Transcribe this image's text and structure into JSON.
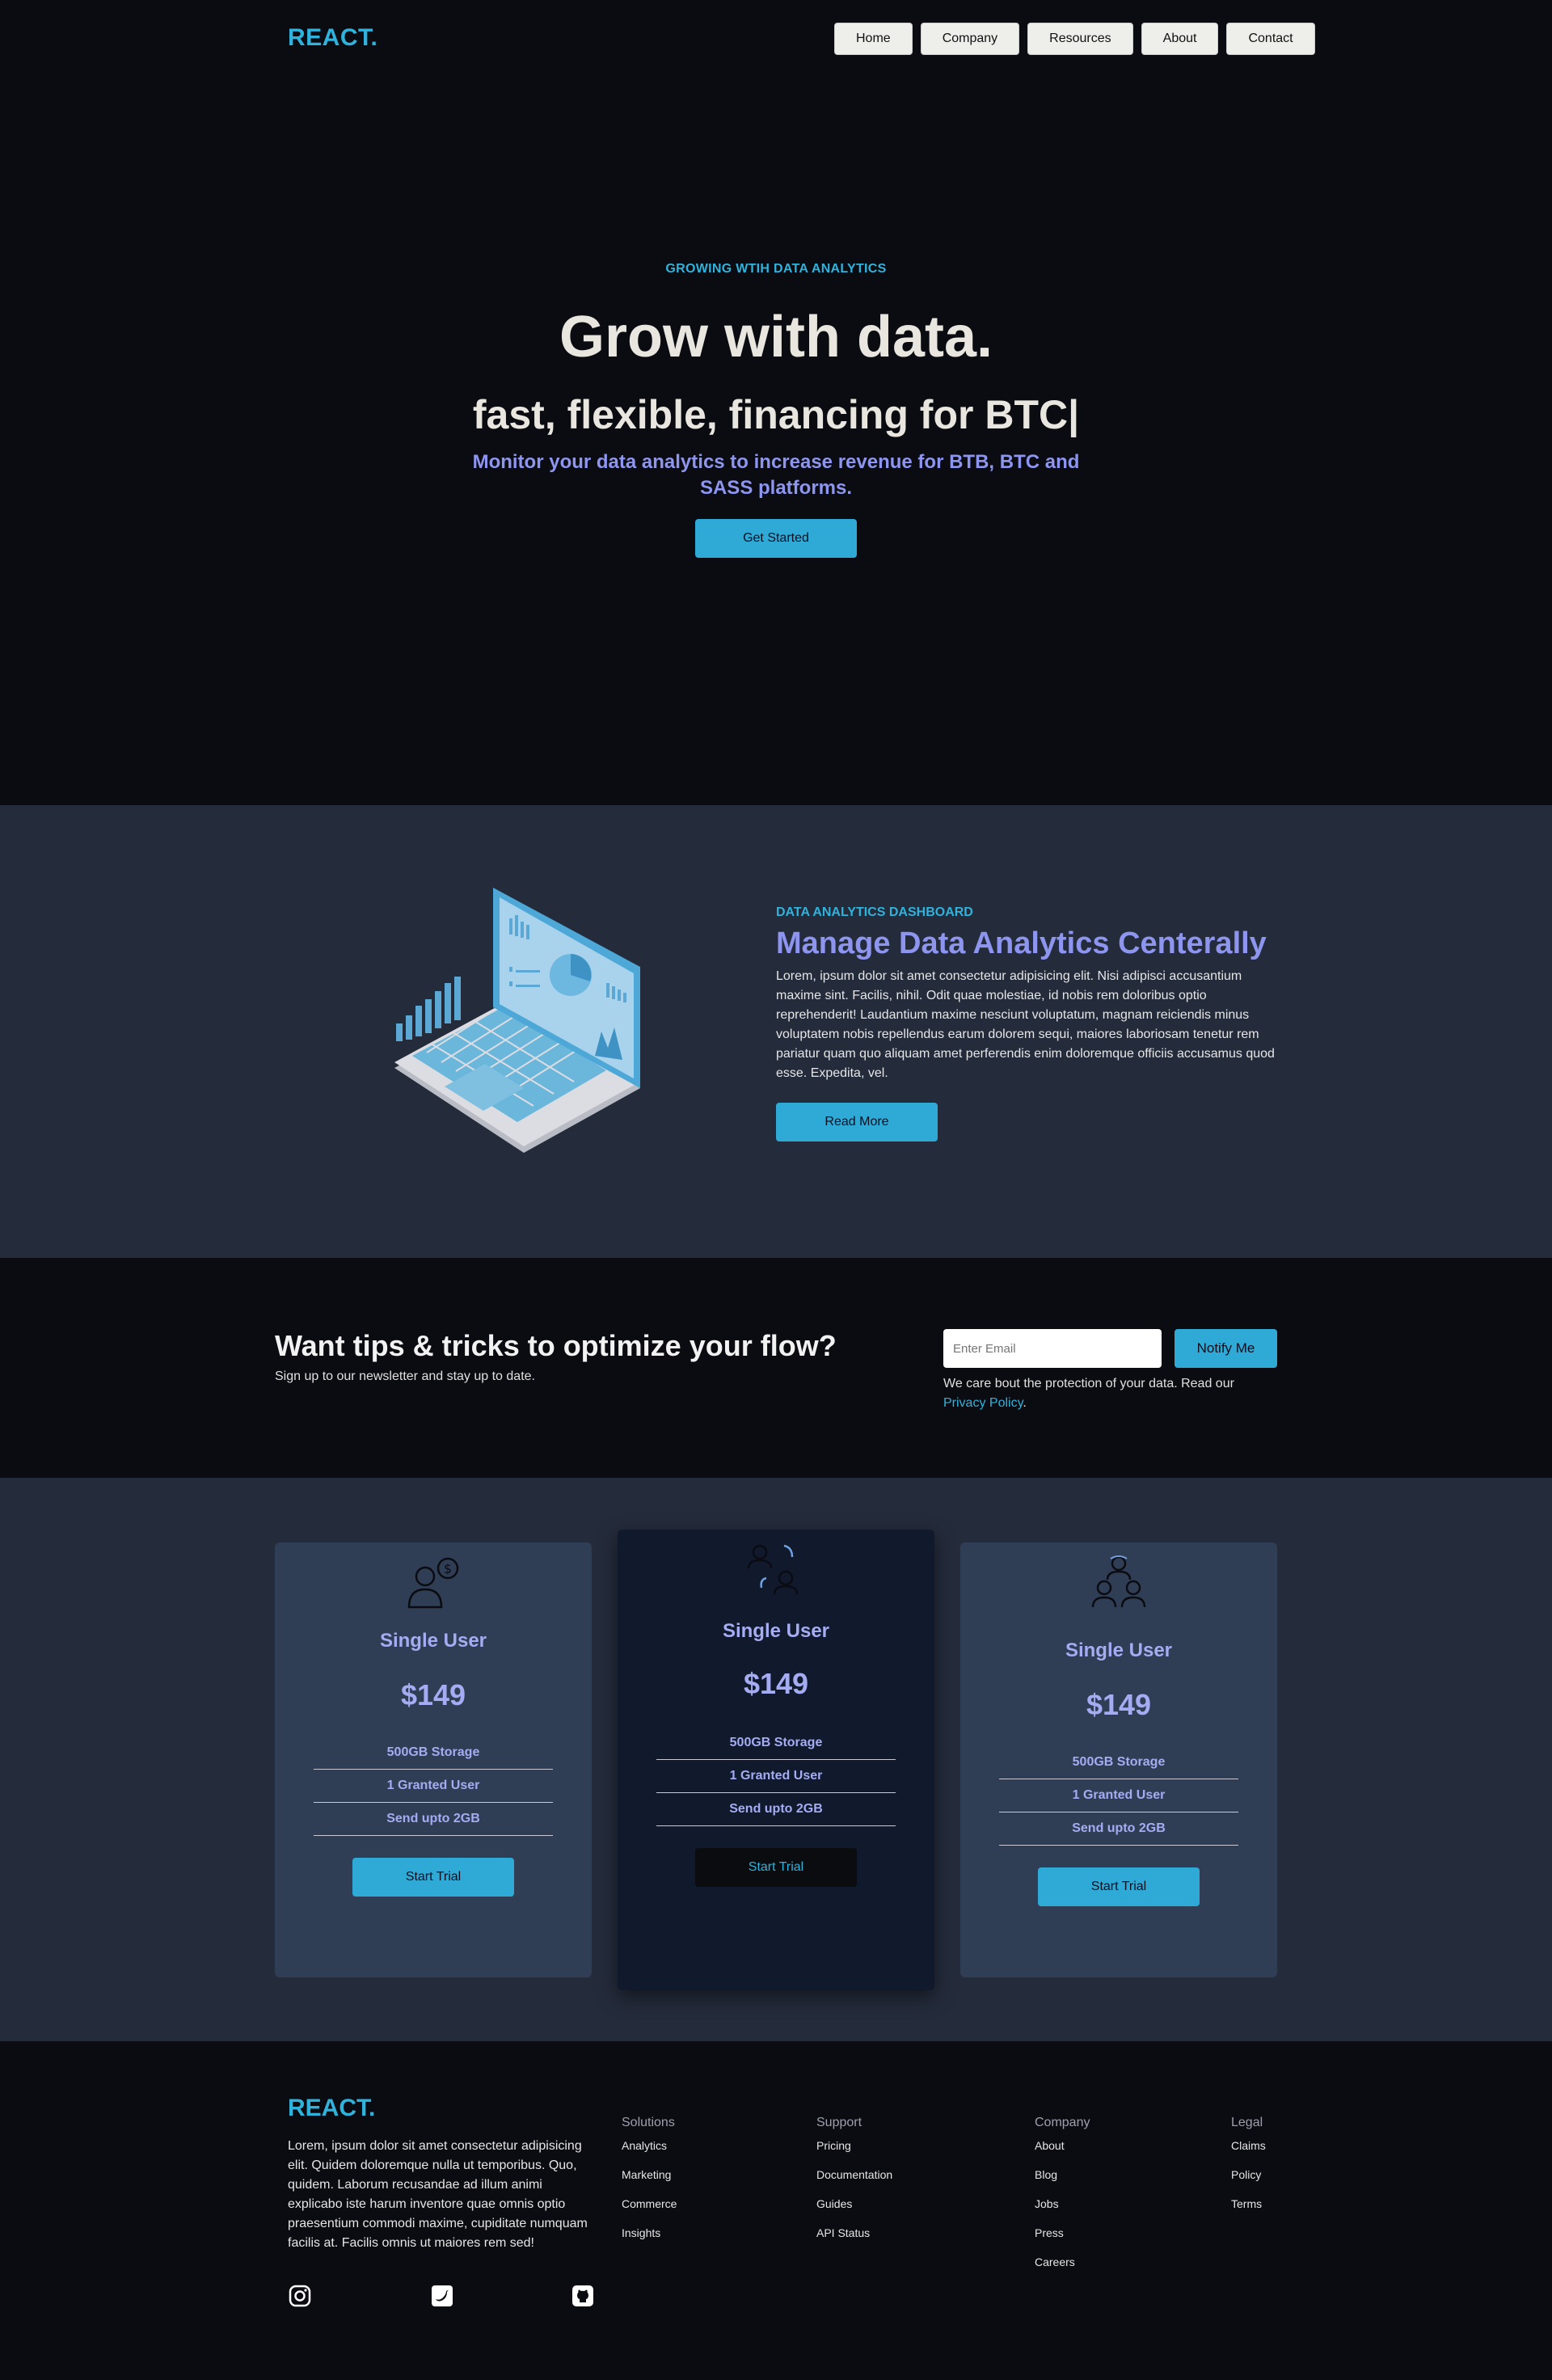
{
  "nav": {
    "logo": "REACT.",
    "links": [
      "Home",
      "Company",
      "Resources",
      "About",
      "Contact"
    ]
  },
  "hero": {
    "eyebrow": "GROWING WTIH DATA ANALYTICS",
    "title": "Grow with data.",
    "typed": "fast, flexible, financing for  BTC|",
    "subtitle": "Monitor your data analytics to increase revenue for BTB, BTC and SASS platforms.",
    "cta": "Get Started"
  },
  "analytics": {
    "eyebrow": "DATA ANALYTICS DASHBOARD",
    "title": "Manage Data Analytics Centerally",
    "text": "Lorem, ipsum dolor sit amet consectetur adipisicing elit. Nisi adipisci accusantium maxime sint. Facilis, nihil. Odit quae molestiae, id nobis rem doloribus optio reprehenderit! Laudantium maxime nesciunt voluptatum, magnam reiciendis minus voluptatem nobis repellendus earum dolorem sequi, maiores laboriosam tenetur rem pariatur quam quo aliquam amet perferendis enim doloremque officiis accusamus quod esse. Expedita, vel.",
    "cta": "Read More"
  },
  "newsletter": {
    "title": "Want tips & tricks to optimize your flow?",
    "subtitle": "Sign up to our newsletter and stay up to date.",
    "placeholder": "Enter Email",
    "button": "Notify Me",
    "note": "We care bout the protection of your data. Read our ",
    "link": "Privacy Policy",
    "note_end": "."
  },
  "pricing": {
    "cards": [
      {
        "name": "Single User",
        "price": "$149",
        "features": [
          "500GB Storage",
          "1 Granted User",
          "Send upto 2GB"
        ],
        "cta": "Start Trial"
      },
      {
        "name": "Single User",
        "price": "$149",
        "features": [
          "500GB Storage",
          "1 Granted User",
          "Send upto 2GB"
        ],
        "cta": "Start Trial"
      },
      {
        "name": "Single User",
        "price": "$149",
        "features": [
          "500GB Storage",
          "1 Granted User",
          "Send upto 2GB"
        ],
        "cta": "Start Trial"
      }
    ]
  },
  "footer": {
    "logo": "REACT.",
    "text": "Lorem, ipsum dolor sit amet consectetur adipisicing elit. Quidem doloremque nulla ut temporibus. Quo, quidem. Laborum recusandae ad illum animi explicabo iste harum inventore quae omnis optio praesentium commodi maxime, cupiditate numquam facilis at. Facilis omnis ut maiores rem sed!",
    "columns": [
      {
        "title": "Solutions",
        "items": [
          "Analytics",
          "Marketing",
          "Commerce",
          "Insights"
        ]
      },
      {
        "title": "Support",
        "items": [
          "Pricing",
          "Documentation",
          "Guides",
          "API Status"
        ]
      },
      {
        "title": "Company",
        "items": [
          "About",
          "Blog",
          "Jobs",
          "Press",
          "Careers"
        ]
      },
      {
        "title": "Legal",
        "items": [
          "Claims",
          "Policy",
          "Terms"
        ]
      }
    ],
    "social": [
      "instagram-icon",
      "twitter-icon",
      "github-icon"
    ]
  },
  "colors": {
    "accent": "#2fb3dc",
    "lavender": "#8d95ef",
    "dark_bg": "#0b0c12",
    "section_bg": "#242b3b",
    "card_bg": "#303e55"
  }
}
